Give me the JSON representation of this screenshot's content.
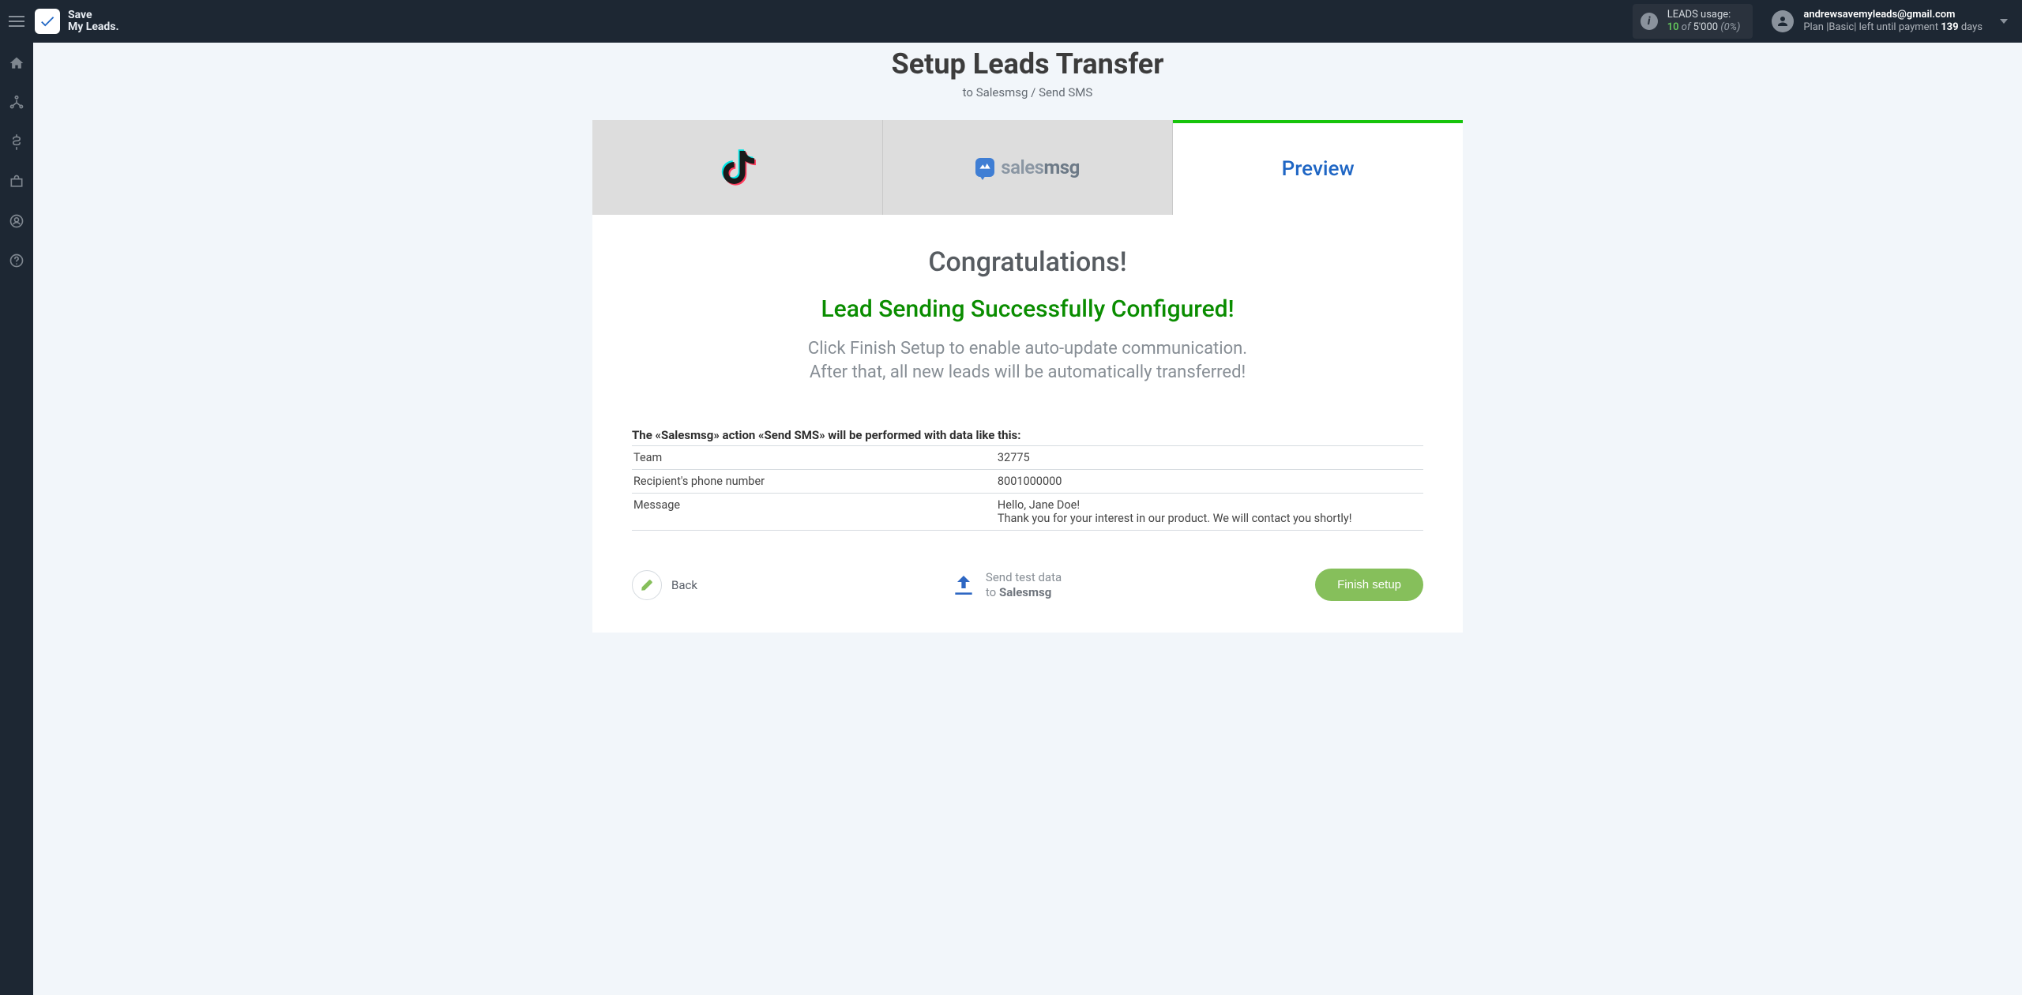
{
  "brand": {
    "line1": "Save",
    "line2": "My Leads."
  },
  "leadsUsage": {
    "title": "LEADS usage:",
    "used": "10",
    "of": "of",
    "quota": "5'000",
    "pct": "(0%)"
  },
  "account": {
    "email": "andrewsavemyleads@gmail.com",
    "plan_prefix": "Plan |Basic| left until payment ",
    "plan_days": "139",
    "plan_suffix": " days"
  },
  "page": {
    "title": "Setup Leads Transfer",
    "subtitle": "to Salesmsg / Send SMS"
  },
  "tabs": {
    "preview_label": "Preview",
    "salesmsg_word": "sales",
    "salesmsg_word_bold": "msg"
  },
  "body": {
    "congrats": "Congratulations!",
    "success": "Lead Sending Successfully Configured!",
    "help1": "Click Finish Setup to enable auto-update communication.",
    "help2": "After that, all new leads will be automatically transferred!",
    "action_sentence": "The «Salesmsg» action «Send SMS» will be performed with data like this:"
  },
  "preview_rows": [
    {
      "label": "Team",
      "value": "32775"
    },
    {
      "label": "Recipient's phone number",
      "value": "8001000000"
    },
    {
      "label": "Message",
      "value": "Hello, Jane Doe!\nThank you for your interest in our product. We will contact you shortly!"
    }
  ],
  "footer": {
    "back": "Back",
    "send_test_line1": "Send test data",
    "send_test_to": "to ",
    "send_test_dest": "Salesmsg",
    "finish": "Finish setup"
  }
}
